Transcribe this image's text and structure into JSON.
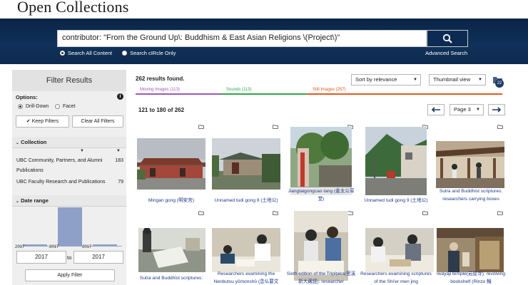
{
  "header": {
    "title": "Open Collections"
  },
  "search": {
    "query": "contributor: \"From the Ground Up\\: Buddhism & East Asian Religions \\(Project\\)\"",
    "scope_all": "Search All Content",
    "scope_circle": "Search cIRcle Only",
    "advanced": "Advanced Search"
  },
  "sidebar": {
    "title": "Filter Results",
    "options_label": "Options:",
    "drill_down": "Drill-Down",
    "facet": "Facet",
    "keep_filters": "Keep Filters",
    "clear_filters": "Clear All Filters",
    "collection_label": "Collection",
    "collections": [
      {
        "name": "UBC Community, Partners, and Alumni Publications",
        "count": "183"
      },
      {
        "name": "UBC Faculty Research and Publications",
        "count": "79"
      }
    ],
    "date_label": "Date range",
    "hist_ticks": [
      "2017",
      "2017",
      "2017"
    ],
    "hist_values": [
      0.04,
      1.0,
      0.04
    ],
    "from_year": "2017",
    "to_label": "to",
    "to_year": "2017",
    "apply": "Apply Filter"
  },
  "results": {
    "found": "262 results found.",
    "sort": "Sort by relevance",
    "view": "Thumbnail view",
    "bucket_count": "22",
    "types": [
      {
        "label": "Moving Images (113)",
        "color": "#9c59b6"
      },
      {
        "label": "Sounds (113)",
        "color": "#2ea84a"
      },
      {
        "label": "Still Images (257)",
        "color": "#e05a1c"
      }
    ],
    "range": "121 to 180 of 262",
    "page": "Page 3"
  },
  "items": [
    {
      "caption": "Mingan gong (明安宮)"
    },
    {
      "caption": "Unnamed tudi gong 8 (土地公)"
    },
    {
      "caption": "Jiangtaigongcao tang (姜太公草堂)"
    },
    {
      "caption": "Unnamed tudi gong 9 (土地公)"
    },
    {
      "caption": "Sutra and Buddhist scriptures: researchers carrying boxes"
    },
    {
      "caption": "Sutra and Buddhist scriptures:"
    },
    {
      "caption": "Researchers examining the Nenbutsu yōmonshō (念仏要文"
    },
    {
      "caption": "Sixth edition of the Tripiṭaka(思溪新大藏經): researcher"
    },
    {
      "caption": "Researchers examining scriptures of the Shi'er men jing"
    },
    {
      "caption": "Iwayaji temple(岩屋寺): revolving bookshelf (Rinzo 輪"
    }
  ]
}
